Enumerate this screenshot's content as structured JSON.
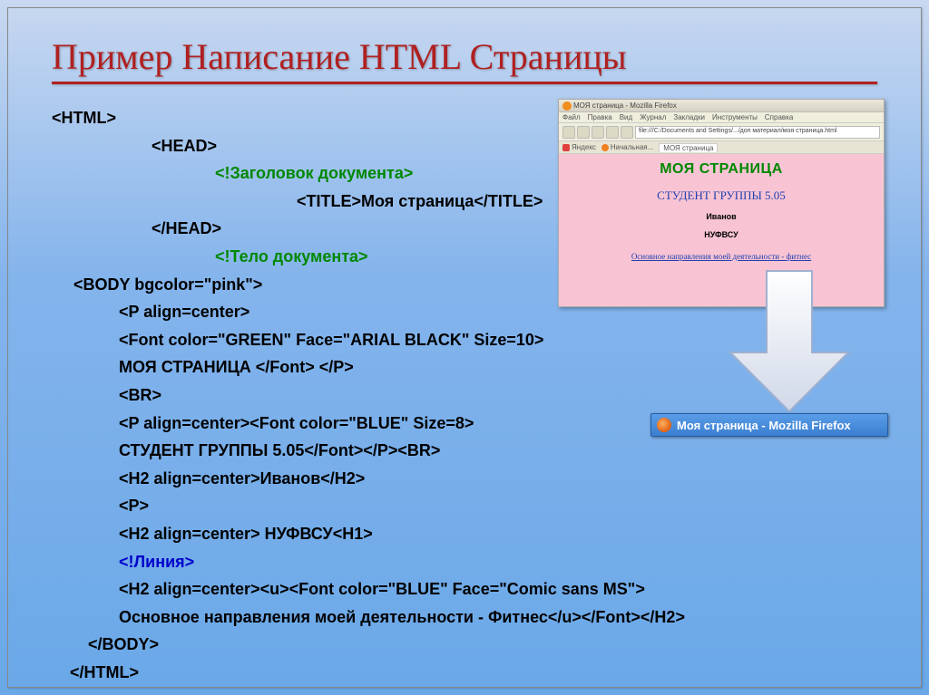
{
  "slide": {
    "title": "Пример Написание HTML Страницы"
  },
  "code": {
    "l01": "<HTML>",
    "l02": "<HEAD>",
    "l03": "<!Заголовок документа>",
    "l04": "<TITLE>Моя страница</TITLE>",
    "l05": "</HEAD>",
    "l06": "<!Тело документа>",
    "l07": "<BODY bgcolor=\"pink\">",
    "l08": "<P align=center>",
    "l09": "<Font color=\"GREEN\" Face=\"ARIAL BLACK\" Size=10>",
    "l10": "МОЯ СТРАНИЦА </Font> </P>",
    "l11": "<BR>",
    "l12": "<P align=center><Font color=\"BLUE\" Size=8>",
    "l13": "СТУДЕНТ ГРУППЫ 5.05</Font></P><BR>",
    "l14": "<H2 align=center>Иванов</H2>",
    "l15": "<P>",
    "l16": "<H2 align=center> НУФВСУ<H1>",
    "l17": "<!Линия>",
    "l18": "<H2 align=center><u><Font color=\"BLUE\" Face=\"Comic sans MS\">",
    "l19": "Основное направления моей деятельности - Фитнес</u></Font></H2>",
    "l20": "</BODY>",
    "l21": "</HTML>"
  },
  "preview": {
    "title_bar": "МОЯ страница - Mozilla Firefox",
    "menu": [
      "Файл",
      "Правка",
      "Вид",
      "Журнал",
      "Закладки",
      "Инструменты",
      "Справка"
    ],
    "address": "file:///C:/Documents and Settings/.../доп материал/моя страница.html",
    "tabs": [
      "Яндекс",
      "Начальная...",
      "МОЯ страница"
    ],
    "h1": "МОЯ СТРАНИЦА",
    "h2": "СТУДЕНТ ГРУППЫ 5.05",
    "t1": "Иванов",
    "t2": "НУФВСУ",
    "link": "Основное направления моей деятельности - фитнес"
  },
  "taskbar": {
    "label": "Моя страница - Mozilla Firefox"
  }
}
